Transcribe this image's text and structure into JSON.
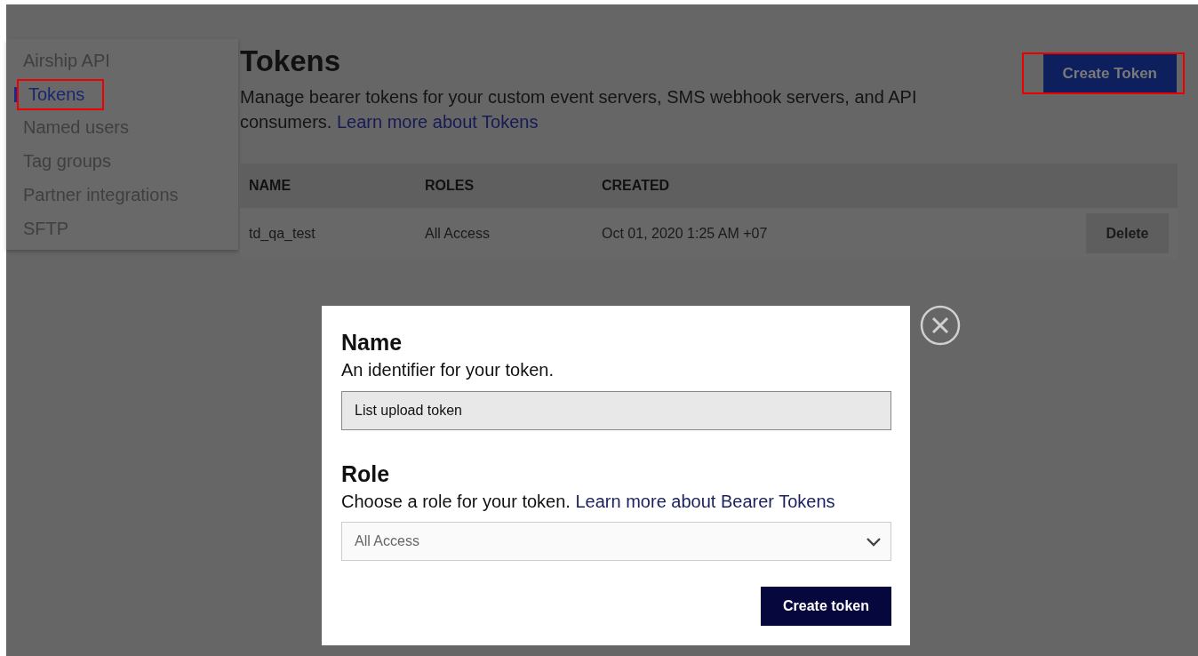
{
  "sidebar": {
    "items": [
      {
        "label": "Airship API",
        "selected": false,
        "highlighted": false
      },
      {
        "label": "Tokens",
        "selected": true,
        "highlighted": true
      },
      {
        "label": "Named users",
        "selected": false,
        "highlighted": false
      },
      {
        "label": "Tag groups",
        "selected": false,
        "highlighted": false
      },
      {
        "label": "Partner integrations",
        "selected": false,
        "highlighted": false
      },
      {
        "label": "SFTP",
        "selected": false,
        "highlighted": false
      }
    ]
  },
  "page": {
    "title": "Tokens",
    "description": "Manage bearer tokens for your custom event servers, SMS webhook servers, and API consumers.",
    "description_link": "Learn more about Tokens",
    "create_button": {
      "label": "Create Token",
      "highlighted": true
    }
  },
  "table": {
    "columns": [
      "NAME",
      "ROLES",
      "CREATED"
    ],
    "rows": [
      {
        "name": "td_qa_test",
        "roles": "All Access",
        "created": "Oct 01, 2020 1:25 AM +07",
        "action": "Delete"
      }
    ]
  },
  "dialog": {
    "name_heading": "Name",
    "name_hint": "An identifier for your token.",
    "name_value": "List upload token",
    "role_heading": "Role",
    "role_hint": "Choose a role for your token.",
    "role_link": "Learn more about Bearer Tokens",
    "role_value": "All Access",
    "submit": "Create token"
  }
}
